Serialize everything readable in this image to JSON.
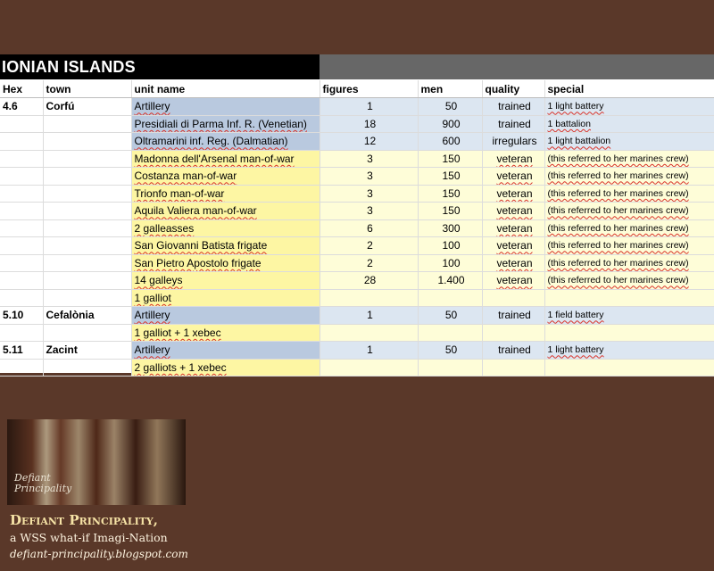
{
  "title": "IONIAN ISLANDS",
  "headers": {
    "hex": "Hex",
    "town": "town",
    "unit": "unit name",
    "figures": "figures",
    "men": "men",
    "quality": "quality",
    "special": "special"
  },
  "rows": [
    {
      "hex": "4.6",
      "town": "Corfú",
      "unit": "Artillery",
      "figures": "1",
      "men": "50",
      "quality": "trained",
      "special": "1 light battery",
      "color": "blue"
    },
    {
      "hex": "",
      "town": "",
      "unit": "Presidiali di Parma Inf. R. (Venetian)",
      "figures": "18",
      "men": "900",
      "quality": "trained",
      "special": "1 battalion",
      "color": "blue"
    },
    {
      "hex": "",
      "town": "",
      "unit": "Oltramarini inf. Reg. (Dalmatian)",
      "figures": "12",
      "men": "600",
      "quality": "irregulars",
      "special": "1 light battalion",
      "color": "blue"
    },
    {
      "hex": "",
      "town": "",
      "unit": "Madonna dell'Arsenal man-of-war",
      "figures": "3",
      "men": "150",
      "quality": "veteran",
      "special": "(this referred to her marines crew)",
      "color": "yellow"
    },
    {
      "hex": "",
      "town": "",
      "unit": "Costanza man-of-war",
      "figures": "3",
      "men": "150",
      "quality": "veteran",
      "special": "(this referred to her marines crew)",
      "color": "yellow"
    },
    {
      "hex": "",
      "town": "",
      "unit": "Trionfo man-of-war",
      "figures": "3",
      "men": "150",
      "quality": "veteran",
      "special": "(this referred to her marines crew)",
      "color": "yellow"
    },
    {
      "hex": "",
      "town": "",
      "unit": "Aquila Valiera man-of-war",
      "figures": "3",
      "men": "150",
      "quality": "veteran",
      "special": "(this referred to her marines crew)",
      "color": "yellow"
    },
    {
      "hex": "",
      "town": "",
      "unit": "2 galleasses",
      "figures": "6",
      "men": "300",
      "quality": "veteran",
      "special": "(this referred to her marines crew)",
      "color": "yellow"
    },
    {
      "hex": "",
      "town": "",
      "unit": "San Giovanni Batista frigate",
      "figures": "2",
      "men": "100",
      "quality": "veteran",
      "special": "(this referred to her marines crew)",
      "color": "yellow"
    },
    {
      "hex": "",
      "town": "",
      "unit": "San Pietro Apostolo frigate",
      "figures": "2",
      "men": "100",
      "quality": "veteran",
      "special": "(this referred to her marines crew)",
      "color": "yellow"
    },
    {
      "hex": "",
      "town": "",
      "unit": "14 galleys",
      "figures": "28",
      "men": "1.400",
      "quality": "veteran",
      "special": "(this referred to her marines crew)",
      "color": "yellow"
    },
    {
      "hex": "",
      "town": "",
      "unit": "1 galliot",
      "figures": "",
      "men": "",
      "quality": "",
      "special": "",
      "color": "yellow"
    },
    {
      "hex": "5.10",
      "town": "Cefalònia",
      "unit": "Artillery",
      "figures": "1",
      "men": "50",
      "quality": "trained",
      "special": "1 field battery",
      "color": "blue"
    },
    {
      "hex": "",
      "town": "",
      "unit": "1 galliot + 1 xebec",
      "figures": "",
      "men": "",
      "quality": "",
      "special": "",
      "color": "yellow"
    },
    {
      "hex": "5.11",
      "town": "Zacint",
      "unit": "Artillery",
      "figures": "1",
      "men": "50",
      "quality": "trained",
      "special": "1 light battery",
      "color": "blue"
    },
    {
      "hex": "",
      "town": "",
      "unit": "2 galliots + 1 xebec",
      "figures": "",
      "men": "",
      "quality": "",
      "special": "",
      "color": "yellow"
    }
  ],
  "logo": {
    "caption_line1": "Defiant",
    "caption_line2": "Principality"
  },
  "credit": {
    "name": "Defiant Principality,",
    "tagline": "a WSS what-if Imagi-Nation",
    "url": "defiant-principality.blogspot.com"
  },
  "colors": {
    "background": "#5a3829",
    "title_bar": "#000000",
    "unit_blue": "#b9c9df",
    "row_blue": "#dce6f1",
    "unit_yellow": "#fdf6a3",
    "row_yellow": "#fefdd8"
  }
}
